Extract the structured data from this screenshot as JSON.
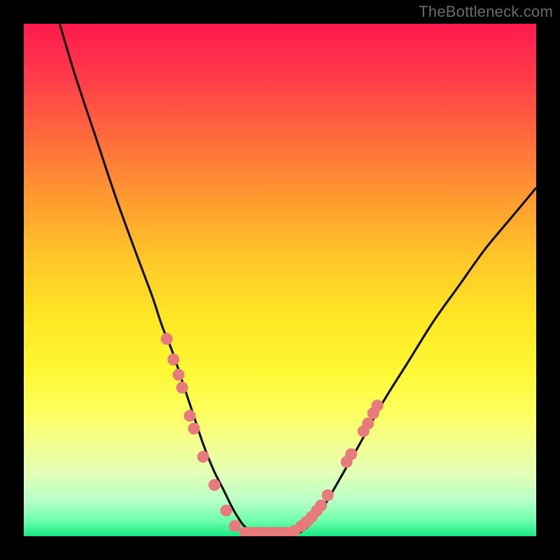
{
  "watermark": "TheBottleneck.com",
  "chart_data": {
    "type": "line",
    "title": "",
    "xlabel": "",
    "ylabel": "",
    "xlim": [
      0,
      100
    ],
    "ylim": [
      0,
      100
    ],
    "series": [
      {
        "name": "bottleneck-curve",
        "x": [
          7,
          10,
          14,
          18,
          22,
          25,
          27,
          29,
          31,
          33,
          35,
          37,
          39,
          41,
          43,
          45,
          47,
          49.5,
          52,
          55,
          58,
          61,
          65,
          70,
          75,
          80,
          85,
          90,
          95,
          100
        ],
        "y": [
          100,
          90,
          78,
          66,
          55,
          47,
          41,
          36,
          30,
          24,
          18,
          13,
          9,
          5,
          2,
          0.5,
          0,
          0,
          0,
          1.5,
          5,
          10,
          17,
          26,
          34,
          42,
          49,
          56,
          62,
          68
        ]
      }
    ],
    "markers_left": {
      "name": "dots-left",
      "x": [
        27.9,
        29.2,
        30.2,
        30.9,
        32.4,
        33.2,
        35.0,
        37.2,
        39.5,
        41.2
      ],
      "y": [
        38.5,
        34.5,
        31.5,
        29.0,
        23.5,
        21.0,
        15.5,
        10.0,
        5.0,
        2.0
      ]
    },
    "markers_right": {
      "name": "dots-right",
      "x": [
        52.8,
        54.2,
        55.2,
        56.2,
        57.2,
        58.0,
        59.3,
        63.0,
        63.9,
        66.3,
        67.2,
        68.2,
        69.0
      ],
      "y": [
        1.0,
        2.0,
        2.8,
        3.8,
        5.0,
        6.0,
        8.0,
        14.5,
        16.0,
        20.5,
        22.0,
        24.0,
        25.5
      ]
    },
    "plateau": {
      "name": "flat-bottom",
      "x": [
        43.0,
        44.2,
        45.4,
        46.6,
        47.8,
        49.0,
        50.2,
        51.4
      ],
      "y": [
        0,
        0,
        0,
        0,
        0,
        0,
        0,
        0
      ]
    },
    "colors": {
      "curve": "#111111",
      "dots_fill": "#e77b7b",
      "dots_stroke": "#e77b7b",
      "plateau_stroke": "#e77b7b"
    }
  }
}
